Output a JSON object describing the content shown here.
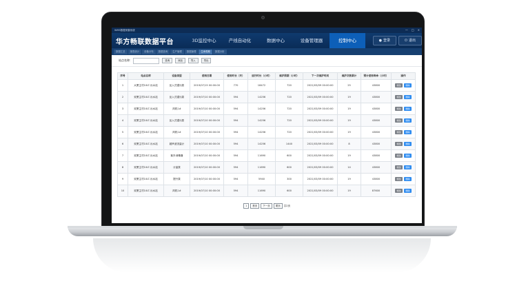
{
  "app": {
    "window_title": "WMS数据采集系统",
    "logo": "华方畅联数据平台",
    "window_controls": [
      "—",
      "□",
      "×"
    ]
  },
  "nav": {
    "items": [
      {
        "label": "3D监控中心",
        "active": false
      },
      {
        "label": "产线自动化",
        "active": false
      },
      {
        "label": "数据中心",
        "active": false
      },
      {
        "label": "设备管理器",
        "active": false
      },
      {
        "label": "控制中心",
        "active": true
      }
    ],
    "login_label": "登录",
    "logout_label": "退出"
  },
  "breadcrumbs": [
    {
      "label": "数据汇总",
      "active": false
    },
    {
      "label": "报表统计",
      "active": false
    },
    {
      "label": "设备分布",
      "active": false
    },
    {
      "label": "数据查询",
      "active": false
    },
    {
      "label": "生产管理",
      "active": false
    },
    {
      "label": "数据管理",
      "active": false
    },
    {
      "label": "生命周期",
      "active": true
    },
    {
      "label": "数据分析",
      "active": false
    }
  ],
  "search": {
    "label": "站点名称:",
    "value": "",
    "buttons": [
      "查询",
      "添加",
      "导入",
      "导出"
    ]
  },
  "table": {
    "headers": [
      "序号",
      "站点名称",
      "设备类型",
      "使用日期",
      "使用时长（天）",
      "运行时长（小时）",
      "维护周期（小时）",
      "下一次维护时间",
      "维护次数累计",
      "预计使用寿命（小时）",
      "操作"
    ],
    "rows": [
      [
        "1",
        "大厦主村10LT-污水站",
        "反入式潜污泵",
        "2019/07/15 00:00:00",
        "770",
        "18472",
        "720",
        "2021/03/09 00:00:00",
        "25",
        "43800"
      ],
      [
        "2",
        "双厦主村10LT-污水站",
        "反入式潜污泵",
        "2019/07/10 00:00:00",
        "594",
        "14256",
        "720",
        "2021/03/09 00:00:00",
        "19",
        "43800"
      ],
      [
        "3",
        "双厦主村10LT-污水站",
        "风机1#",
        "2019/07/10 00:00:00",
        "594",
        "14256",
        "720",
        "2021/03/09 00:00:00",
        "19",
        "43800"
      ],
      [
        "4",
        "双厦主村10LT-污水站",
        "反入式潜污泵",
        "2019/07/10 00:00:00",
        "594",
        "14256",
        "720",
        "2021/03/09 00:00:00",
        "19",
        "43800"
      ],
      [
        "5",
        "双厦主村10LT-污水站",
        "风机1#",
        "2019/07/10 00:00:00",
        "594",
        "14256",
        "720",
        "2021/03/09 00:00:00",
        "19",
        "43800"
      ],
      [
        "6",
        "双厦主村10LT-污水站",
        "超声波流量计",
        "2019/07/10 00:00:00",
        "594",
        "14256",
        "1440",
        "2021/03/09 00:00:00",
        "8",
        "43800"
      ],
      [
        "7",
        "双厦主村10LT-污水站",
        "紫外消毒器",
        "2019/07/10 00:00:00",
        "594",
        "11690",
        "600",
        "2021/03/09 00:00:00",
        "19",
        "43800"
      ],
      [
        "8",
        "双厦主村10LT-污水站",
        "计量泵",
        "2019/07/10 00:00:00",
        "594",
        "11690",
        "600",
        "2021/03/09 00:00:00",
        "14",
        "43800"
      ],
      [
        "9",
        "双厦主村10LT-污水站",
        "提升泵",
        "2019/07/10 00:00:00",
        "594",
        "5940",
        "300",
        "2021/03/09 00:00:00",
        "19",
        "43800"
      ],
      [
        "10",
        "双厦主村10LT-污水站",
        "风机1#",
        "2019/07/10 00:00:00",
        "594",
        "11690",
        "600",
        "2021/03/09 00:00:00",
        "19",
        "87600"
      ]
    ],
    "edit_label": "修改",
    "delete_label": "删除"
  },
  "pager": {
    "current": "1",
    "prev": "首页",
    "next": "下一页",
    "last": "尾页",
    "total": "共2页"
  },
  "colors": {
    "header": "#0f3a6e",
    "nav_active": "#0d5fb8",
    "delete_button": "#2f8cf0"
  }
}
